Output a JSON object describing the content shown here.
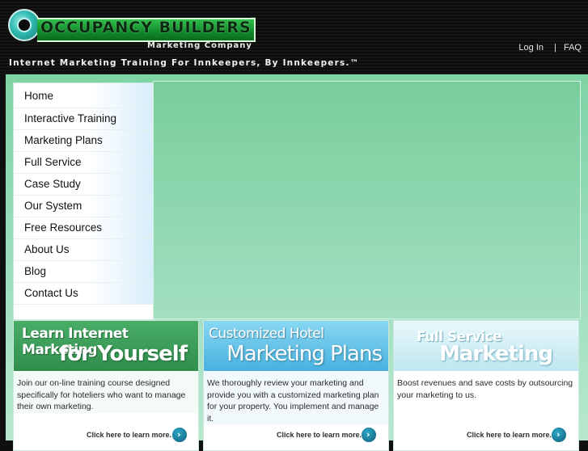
{
  "header": {
    "logo_word": "OCCUPANCY BUILDERS",
    "logo_tm": "™",
    "logo_subtitle": "Marketing Company",
    "tagline": "Internet Marketing Training For Innkeepers, By Innkeepers.™",
    "links": {
      "login": "Log In",
      "separator": "|",
      "faq": "FAQ"
    }
  },
  "sidebar": {
    "items": [
      {
        "label": "Home"
      },
      {
        "label": "Interactive Training"
      },
      {
        "label": "Marketing Plans"
      },
      {
        "label": "Full Service"
      },
      {
        "label": "Case Study"
      },
      {
        "label": "Our System"
      },
      {
        "label": "Free Resources"
      },
      {
        "label": "About Us"
      },
      {
        "label": "Blog"
      },
      {
        "label": "Contact Us"
      }
    ]
  },
  "cards": [
    {
      "banner_line1": "Learn Internet Marketing",
      "banner_line2": "for Yourself",
      "text": "Join our on-line training course designed specifically for hoteliers who want to manage their own marketing.",
      "cta": "Click here to learn more."
    },
    {
      "banner_line1": "Customized Hotel",
      "banner_line2": "Marketing Plans",
      "text": "We thoroughly review your marketing and provide you with a customized marketing plan for your property. You implement and manage it.",
      "cta": "Click here to learn more."
    },
    {
      "banner_line1": "Full Service",
      "banner_line2": "Marketing",
      "text": "Boost revenues and save costs by outsourcing your marketing to us.",
      "cta": "Click here to learn more."
    }
  ],
  "colors": {
    "header_bg": "#111111",
    "main_green": "#8fd9b0",
    "card1_banner": "#3f9f5c",
    "card2_banner": "#5bbde6",
    "card3_banner": "#d6f1f6",
    "cta_button": "#0f6e8a"
  },
  "icons": {
    "cta_arrow": "chevron-right-icon",
    "logo_mark": "ring-logo-icon"
  }
}
